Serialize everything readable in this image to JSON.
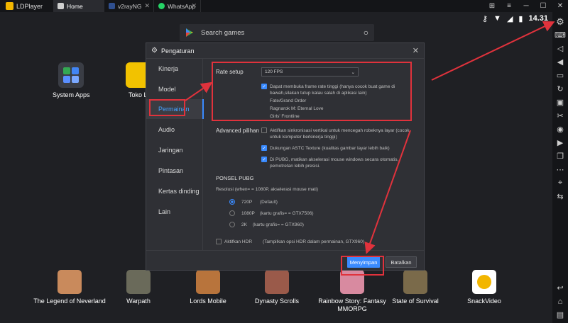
{
  "titlebar": {
    "app_name": "LDPlayer",
    "tabs": [
      {
        "label": "Home",
        "active": true
      },
      {
        "label": "v2rayNG",
        "active": false
      },
      {
        "label": "WhatsApp",
        "active": false
      }
    ],
    "controls": [
      "gamepad-icon",
      "menu-icon",
      "minimize-icon",
      "maximize-icon",
      "close-icon"
    ]
  },
  "status": {
    "time": "14.31"
  },
  "search": {
    "placeholder": "Search games"
  },
  "desktop_apps": [
    {
      "label": "System Apps",
      "color": "#3a3d45"
    },
    {
      "label": "Toko Li",
      "color": "#f2c200"
    }
  ],
  "dock_apps": [
    {
      "label": "The Legend of Neverland",
      "color": "#c98a5c"
    },
    {
      "label": "Warpath",
      "color": "#6a6a5a"
    },
    {
      "label": "Lords Mobile",
      "color": "#b8743c"
    },
    {
      "label": "Dynasty Scrolls",
      "color": "#9a5a4a"
    },
    {
      "label": "Rainbow Story: Fantasy MMORPG",
      "color": "#d88aa0"
    },
    {
      "label": "State of Survival",
      "color": "#7a6a4a"
    },
    {
      "label": "SnackVideo",
      "color": "#ffffff"
    }
  ],
  "dialog": {
    "title": "Pengaturan",
    "nav": [
      "Kinerja",
      "Model",
      "Permainan",
      "Audio",
      "Jaringan",
      "Pintasan",
      "Kertas dinding",
      "Lain"
    ],
    "rate_setup": {
      "label": "Rate setup",
      "value": "120 FPS",
      "checkbox_text": "Dapat membuka frame rate tinggi  (hanya cocok buat game di bawah,silakan tutup kalau salah di aplikasi lain)",
      "games": [
        "Fate/Grand Order",
        "Ragnarok M: Eternal Love",
        "Girls' Frontline"
      ]
    },
    "advanced": {
      "label": "Advanced pilihan",
      "options": [
        {
          "text": "Aktifkan sinkronisasi vertikal untuk mencegah robeknya layar    (cocok untuk komputer berkinerja tinggi)",
          "checked": false
        },
        {
          "text": "Dukungan ASTC Texture    (kualitas gambar layar  lebih baik)",
          "checked": true
        },
        {
          "text": "Di PUBG, matikan akselerasi mouse windows secara otomatis, pemotretan lebih presisi.",
          "checked": true
        }
      ]
    },
    "pubg": {
      "heading": "PONSEL PUBG",
      "resolution_note": "Resolusi    (when= = 1080P, akselerasi mouse mati)",
      "options": [
        {
          "label": "720P",
          "note": "(Default)",
          "selected": true
        },
        {
          "label": "1080P",
          "note": "(kartu grafis= = GTX7506)",
          "selected": false
        },
        {
          "label": "2K",
          "note": "(kartu grafis= = GTX960)",
          "selected": false
        }
      ],
      "hdr": {
        "label": "Aktifkan HDR",
        "note": "(Tampilkan opsi HDR dalam permainan, GTX960)",
        "checked": false
      }
    },
    "save_label": "Menyimpan",
    "cancel_label": "Batalkan"
  },
  "colors": {
    "accent": "#3a8bff",
    "annotation": "#e0323c",
    "background": "#1f2024"
  }
}
